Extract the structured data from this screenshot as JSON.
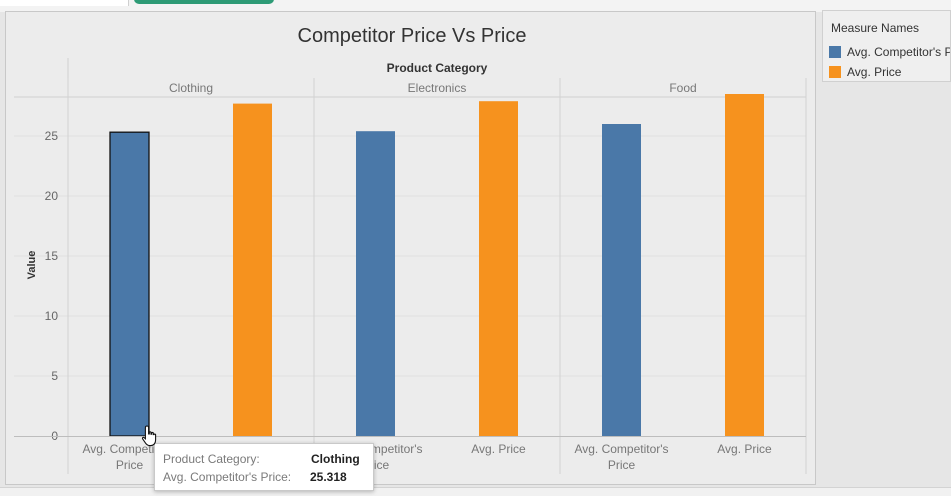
{
  "chart_data": {
    "type": "bar",
    "title": "Competitor Price Vs Price",
    "column_header": "Product Category",
    "ylabel": "Value",
    "ylim": [
      0,
      29
    ],
    "yticks": [
      0,
      5,
      10,
      15,
      20,
      25
    ],
    "panels": [
      "Clothing",
      "Electronics",
      "Food"
    ],
    "bar_labels": [
      [
        "Avg. Competitor's",
        "Price"
      ],
      [
        "Avg. Price"
      ],
      [
        "Avg. Competitor's",
        "Price"
      ],
      [
        "Avg. Price"
      ],
      [
        "Avg. Competitor's",
        "Price"
      ],
      [
        "Avg. Price"
      ]
    ],
    "series": [
      {
        "name": "Avg. Competitor's Price",
        "color": "#4a78a8",
        "values": [
          25.318,
          25.4,
          26.0
        ]
      },
      {
        "name": "Avg. Price",
        "color": "#f6921e",
        "values": [
          27.7,
          27.9,
          28.5
        ]
      }
    ],
    "highlighted": {
      "panel": 0,
      "series": 0
    }
  },
  "legend": {
    "title": "Measure Names",
    "items": [
      {
        "label": "Avg. Competitor's Price",
        "color": "#4a78a8"
      },
      {
        "label": "Avg. Price",
        "color": "#f6921e"
      }
    ]
  },
  "tooltip": {
    "rows": [
      {
        "key": "Product Category:",
        "value": "Clothing"
      },
      {
        "key": "Avg. Competitor's Price:",
        "value": "25.318"
      }
    ]
  }
}
